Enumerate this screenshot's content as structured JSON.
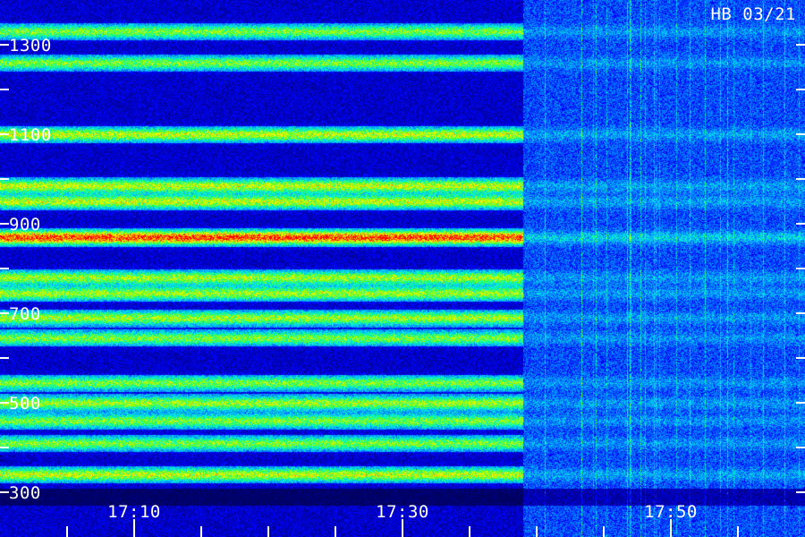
{
  "chart_data": {
    "type": "heatmap",
    "title": "HB 03/21",
    "xlabel": "",
    "ylabel": "",
    "x_ticks": [
      "17:10",
      "17:30",
      "17:50"
    ],
    "y_ticks": [
      "300",
      "500",
      "700",
      "900",
      "1100",
      "1300"
    ],
    "x_range_minutes": [
      0,
      60
    ],
    "x_tick_minutes": [
      10,
      30,
      50
    ],
    "y_range": [
      200,
      1400
    ],
    "y_tick_values": [
      300,
      500,
      700,
      900,
      1100,
      1300
    ],
    "y_minor_step": 100,
    "x_minor_step_minutes": 5,
    "signal_end_minute": 39,
    "bands": [
      {
        "y": 1330,
        "intensity": 0.45
      },
      {
        "y": 1260,
        "intensity": 0.45
      },
      {
        "y": 1100,
        "intensity": 0.55
      },
      {
        "y": 985,
        "intensity": 0.55
      },
      {
        "y": 950,
        "intensity": 0.55
      },
      {
        "y": 870,
        "intensity": 0.9
      },
      {
        "y": 780,
        "intensity": 0.5
      },
      {
        "y": 745,
        "intensity": 0.5
      },
      {
        "y": 690,
        "intensity": 0.5
      },
      {
        "y": 645,
        "intensity": 0.45
      },
      {
        "y": 545,
        "intensity": 0.45
      },
      {
        "y": 500,
        "intensity": 0.5
      },
      {
        "y": 460,
        "intensity": 0.45
      },
      {
        "y": 410,
        "intensity": 0.45
      },
      {
        "y": 340,
        "intensity": 0.55
      }
    ],
    "colormap": [
      "#000018",
      "#000080",
      "#0000ff",
      "#0060ff",
      "#00c0ff",
      "#00ffc0",
      "#40ff40",
      "#c0ff00",
      "#ffff00",
      "#ff8000",
      "#ff0000"
    ]
  }
}
